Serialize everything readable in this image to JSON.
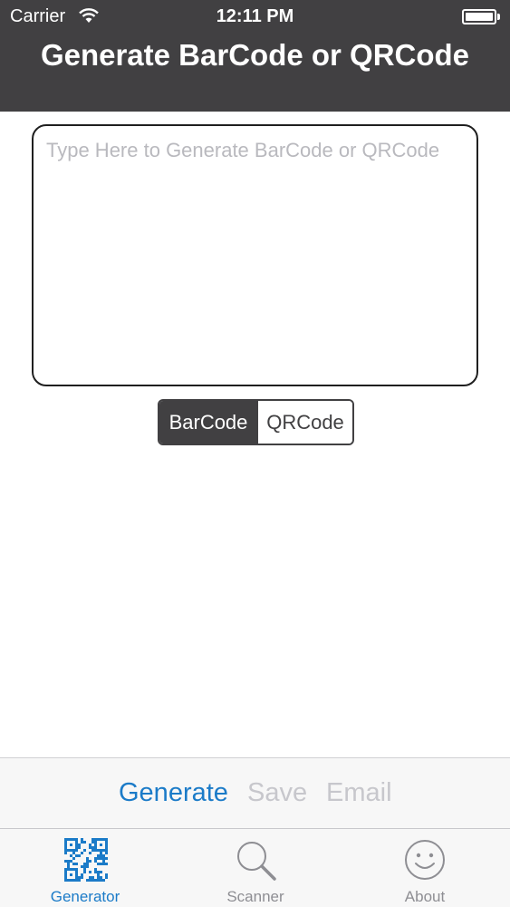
{
  "status_bar": {
    "carrier": "Carrier",
    "time": "12:11 PM",
    "wifi_icon": "wifi-icon",
    "battery_icon": "battery-icon",
    "battery_level": 1.0
  },
  "header": {
    "title": "Generate BarCode or QRCode"
  },
  "input": {
    "value": "",
    "placeholder": "Type Here to Generate BarCode or QRCode"
  },
  "segmented": {
    "options": [
      "BarCode",
      "QRCode"
    ],
    "selected": "BarCode"
  },
  "toolbar": {
    "generate_label": "Generate",
    "save_label": "Save",
    "email_label": "Email"
  },
  "tab_bar": {
    "items": [
      {
        "label": "Generator",
        "icon": "qr-code-icon",
        "active": true
      },
      {
        "label": "Scanner",
        "icon": "magnifier-icon",
        "active": false
      },
      {
        "label": "About",
        "icon": "smiley-icon",
        "active": false
      }
    ]
  },
  "colors": {
    "header_bg": "#414042",
    "accent": "#1b7bc8",
    "disabled": "#c7c7cc",
    "inactive_tab": "#8e8e93"
  }
}
